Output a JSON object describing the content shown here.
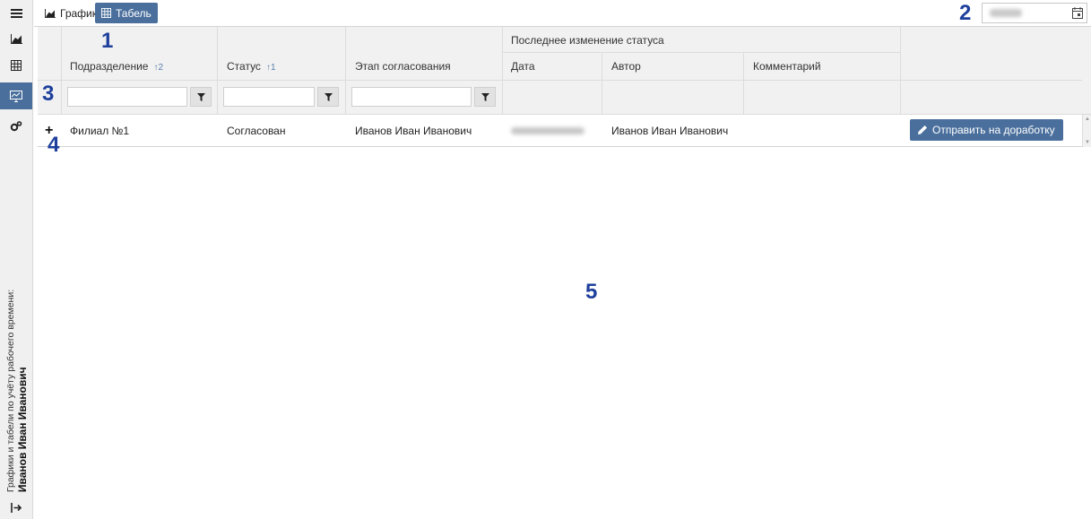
{
  "sidebar": {
    "items": [
      {
        "icon": "menu-icon"
      },
      {
        "icon": "chart-icon"
      },
      {
        "icon": "table-icon"
      },
      {
        "icon": "monitor-icon",
        "active": true
      },
      {
        "icon": "gears-icon"
      }
    ],
    "caption_line1": "Графики и табели по учёту рабочего времени:",
    "caption_user": "Иванов Иван Иванович",
    "logout_icon": "logout-icon"
  },
  "toolbar": {
    "tabs": [
      {
        "label": "График",
        "icon": "chart-icon",
        "active": false
      },
      {
        "label": "Табель",
        "icon": "table-icon",
        "active": true
      }
    ],
    "calendar_icon": "calendar-icon"
  },
  "annotations": [
    "1",
    "2",
    "3",
    "4",
    "5"
  ],
  "grid": {
    "group_header": "Последнее изменение статуса",
    "columns": [
      {
        "label": "Подразделение",
        "sort": "↑2"
      },
      {
        "label": "Статус",
        "sort": "↑1"
      },
      {
        "label": "Этап согласования"
      },
      {
        "label": "Дата"
      },
      {
        "label": "Автор"
      },
      {
        "label": "Комментарий"
      }
    ],
    "filter_icon": "filter-icon",
    "rows": [
      {
        "expand": "+",
        "division": "Филиал №1",
        "status": "Согласован",
        "stage": "Иванов Иван Иванович",
        "author": "Иванов Иван Иванович",
        "comment": "",
        "action_label": "Отправить на доработку",
        "action_icon": "pencil-icon"
      }
    ]
  },
  "colors": {
    "accent": "#4a6f9c",
    "annotation": "#1e3f9c"
  }
}
